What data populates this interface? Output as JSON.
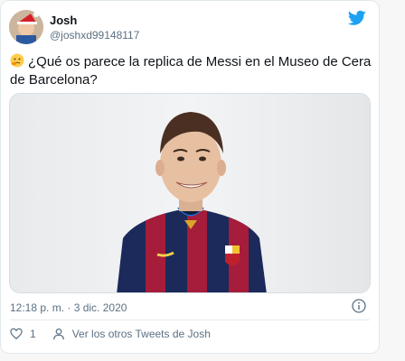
{
  "tweet": {
    "display_name": "Josh",
    "handle": "@joshxd99148117",
    "text_line1": "¿Qué os parece la replica de Messi en el Museo de Cera",
    "text_line2": "de Barcelona?",
    "timestamp": "12:18 p. m. · 3 dic. 2020",
    "like_count": "1",
    "more_tweets_label": "Ver los otros Tweets de Josh"
  },
  "icons": {
    "brand": "twitter-bird-icon",
    "emoji": "thinking-face-icon",
    "info": "info-icon",
    "like": "heart-icon",
    "profile": "person-icon"
  },
  "colors": {
    "twitter_blue": "#1da1f2",
    "secondary_text": "#5b7083",
    "barca_blue": "#1b2a5a",
    "barca_red": "#a51d3a"
  }
}
